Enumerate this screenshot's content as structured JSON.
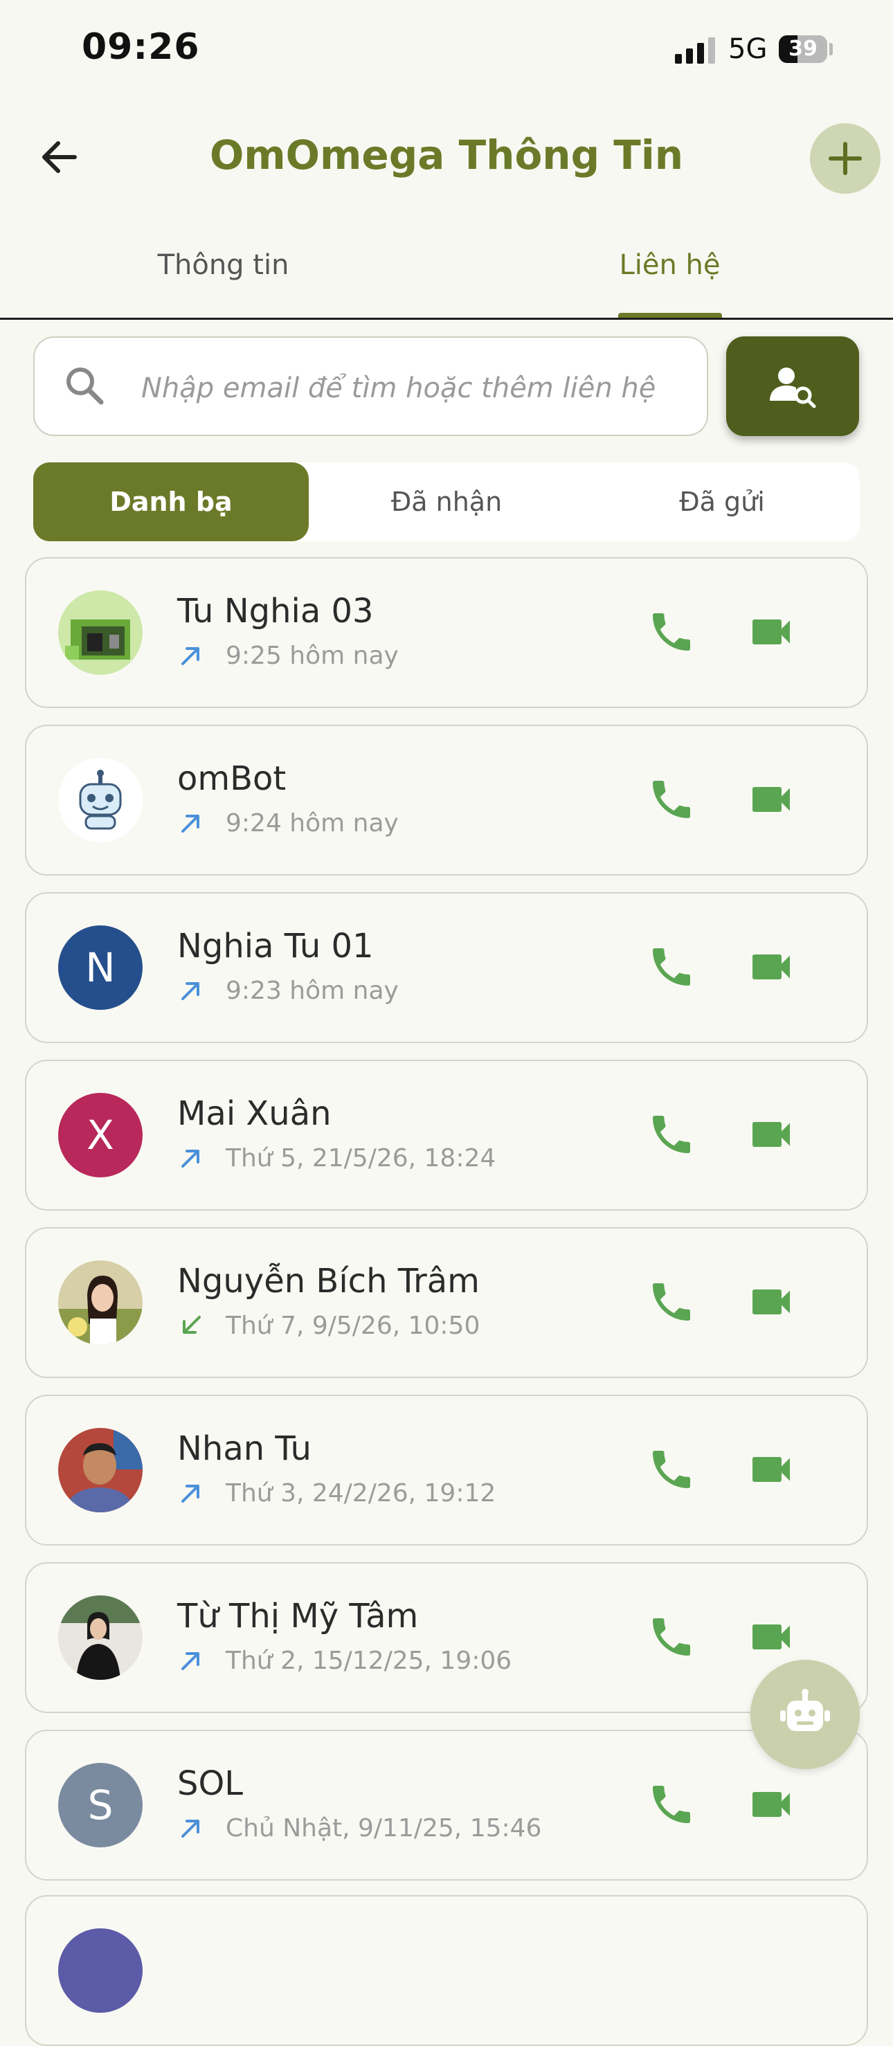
{
  "status_bar": {
    "time": "09:26",
    "network": "5G",
    "battery_percent": "39",
    "battery_level": 0.39
  },
  "header": {
    "title": "OmOmega Thông Tin",
    "back_icon": "arrow-left-icon",
    "add_icon": "plus-icon"
  },
  "tabs": [
    {
      "label": "Thông tin",
      "active": false
    },
    {
      "label": "Liên hệ",
      "active": true
    }
  ],
  "search": {
    "placeholder": "Nhập email để tìm hoặc thêm liên hệ",
    "value": "",
    "button_icon": "person-search-icon"
  },
  "segments": [
    {
      "label": "Danh bạ",
      "active": true
    },
    {
      "label": "Đã nhận",
      "active": false
    },
    {
      "label": "Đã gửi",
      "active": false
    }
  ],
  "contacts": [
    {
      "name": "Tu Nghia 03",
      "time": "9:25 hôm nay",
      "direction": "outgoing",
      "avatar": {
        "type": "image",
        "image": "pixel-art"
      }
    },
    {
      "name": "omBot",
      "time": "9:24 hôm nay",
      "direction": "outgoing",
      "avatar": {
        "type": "image",
        "image": "robot"
      }
    },
    {
      "name": "Nghia Tu 01",
      "time": "9:23 hôm nay",
      "direction": "outgoing",
      "avatar": {
        "type": "initial",
        "initial": "N",
        "color": "#254f8c"
      }
    },
    {
      "name": "Mai Xuân",
      "time": "Thứ 5, 21/5/26, 18:24",
      "direction": "outgoing",
      "avatar": {
        "type": "initial",
        "initial": "X",
        "color": "#b8285a"
      }
    },
    {
      "name": "Nguyễn Bích Trâm",
      "time": "Thứ 7, 9/5/26, 10:50",
      "direction": "incoming",
      "avatar": {
        "type": "image",
        "image": "photo-woman"
      }
    },
    {
      "name": "Nhan Tu",
      "time": "Thứ 3, 24/2/26, 19:12",
      "direction": "outgoing",
      "avatar": {
        "type": "image",
        "image": "photo-man"
      }
    },
    {
      "name": "Từ Thị Mỹ Tâm",
      "time": "Thứ 2, 15/12/25, 19:06",
      "direction": "outgoing",
      "avatar": {
        "type": "image",
        "image": "photo-woman-dark"
      }
    },
    {
      "name": "SOL",
      "time": "Chủ Nhật, 9/11/25, 15:46",
      "direction": "outgoing",
      "avatar": {
        "type": "initial",
        "initial": "S",
        "color": "#7a8ba0"
      }
    }
  ],
  "colors": {
    "accent": "#6b7a28",
    "accent_dark": "#4f5e1c",
    "call_green": "#5aa552",
    "outgoing_arrow": "#4a90d9",
    "incoming_arrow": "#5aa552"
  },
  "fab": {
    "icon": "robot-icon"
  }
}
